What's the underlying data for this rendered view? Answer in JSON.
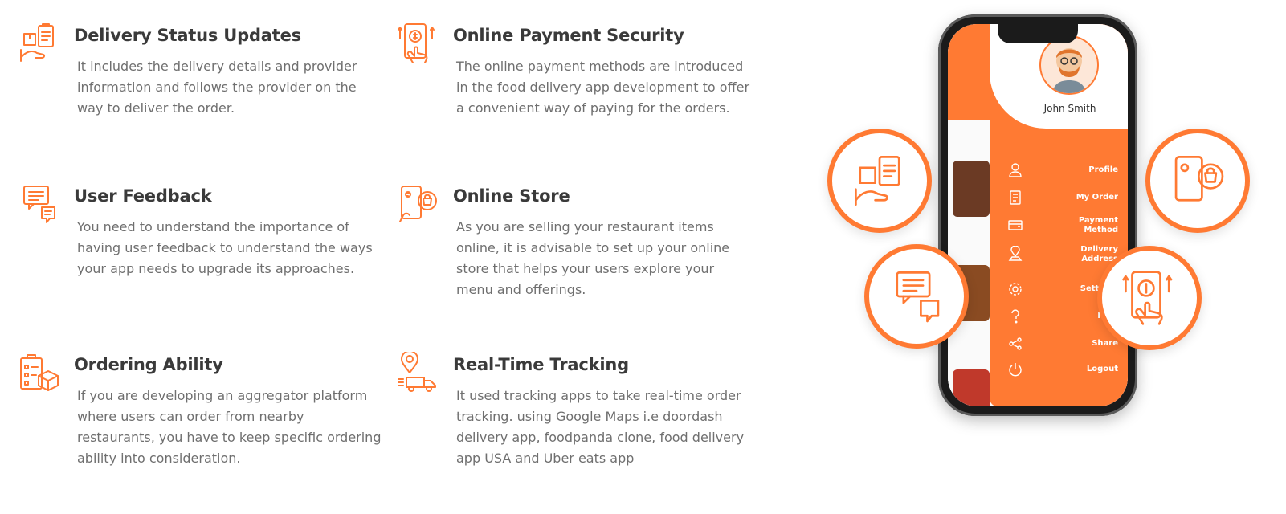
{
  "features": [
    {
      "title": "Delivery Status Updates",
      "text": "It includes the delivery details and provider information and follows the provider on the way to deliver the order.",
      "icon": "delivery-status-icon"
    },
    {
      "title": "Online Payment Security",
      "text": "The online payment methods are introduced in the food delivery app development to offer a convenient way of paying for the orders.",
      "icon": "payment-security-icon"
    },
    {
      "title": "User Feedback",
      "text": "You need to understand the importance of having user feedback to understand the ways your app needs to upgrade its approaches.",
      "icon": "feedback-icon"
    },
    {
      "title": "Online Store",
      "text": "As you are selling your restaurant items online, it is advisable to set up your online store that helps your users explore your menu and offerings.",
      "icon": "online-store-icon"
    },
    {
      "title": "Ordering Ability",
      "text": "If you are developing an aggregator platform where users can order from nearby restaurants, you have to keep specific ordering ability into consideration.",
      "icon": "ordering-icon"
    },
    {
      "title": "Real-Time Tracking",
      "text": "It used tracking apps to take real-time order tracking. using Google Maps i.e doordash delivery app, foodpanda clone, food delivery app USA and Uber eats app",
      "icon": "tracking-icon"
    }
  ],
  "phone": {
    "user_name": "John Smith",
    "menu": [
      {
        "label": "Profile",
        "icon": "user-icon"
      },
      {
        "label": "My Order",
        "icon": "order-list-icon"
      },
      {
        "label": "Payment\nMethod",
        "icon": "wallet-icon"
      },
      {
        "label": "Delivery\nAddress",
        "icon": "map-pin-icon"
      },
      {
        "label": "Settings",
        "icon": "gear-icon"
      },
      {
        "label": "Help",
        "icon": "help-icon"
      },
      {
        "label": "Share",
        "icon": "share-icon"
      },
      {
        "label": "Logout",
        "icon": "power-icon"
      }
    ]
  },
  "colors": {
    "accent": "#ff7a33",
    "heading": "#3a3a3a",
    "body": "#6f6f6f"
  }
}
